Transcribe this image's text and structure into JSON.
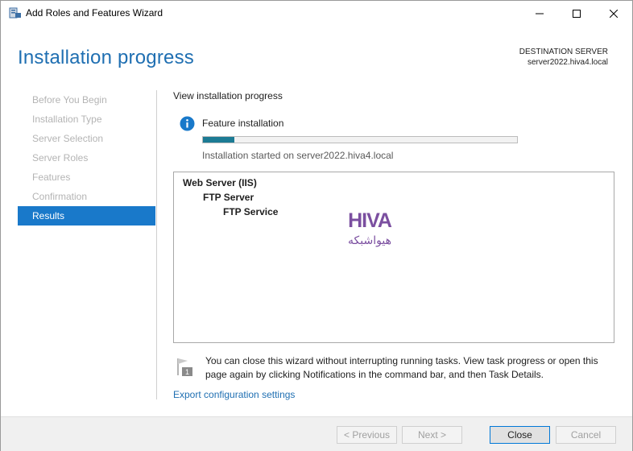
{
  "window": {
    "title": "Add Roles and Features Wizard"
  },
  "header": {
    "page_title": "Installation progress",
    "destination_label": "DESTINATION SERVER",
    "destination_server": "server2022.hiva4.local"
  },
  "nav": {
    "items": [
      {
        "label": "Before You Begin",
        "active": false
      },
      {
        "label": "Installation Type",
        "active": false
      },
      {
        "label": "Server Selection",
        "active": false
      },
      {
        "label": "Server Roles",
        "active": false
      },
      {
        "label": "Features",
        "active": false
      },
      {
        "label": "Confirmation",
        "active": false
      },
      {
        "label": "Results",
        "active": true
      }
    ]
  },
  "main": {
    "heading": "View installation progress",
    "feature_label": "Feature installation",
    "progress_fraction": 0.1,
    "install_status": "Installation started on server2022.hiva4.local",
    "results": [
      {
        "label": "Web Server (IIS)",
        "level": 1
      },
      {
        "label": "FTP Server",
        "level": 2
      },
      {
        "label": "FTP Service",
        "level": 3
      }
    ],
    "logo_text": "HIVA",
    "logo_subtext": "هیواشبکه",
    "note": "You can close this wizard without interrupting running tasks. View task progress or open this page again by clicking Notifications in the command bar, and then Task Details.",
    "note_badge": "1",
    "export_link": "Export configuration settings"
  },
  "footer": {
    "previous": "< Previous",
    "next": "Next >",
    "close": "Close",
    "cancel": "Cancel"
  },
  "colors": {
    "accent": "#1f6fb2",
    "nav_active": "#1979ca",
    "progress": "#1c7b94",
    "logo": "#7b4fa0"
  }
}
